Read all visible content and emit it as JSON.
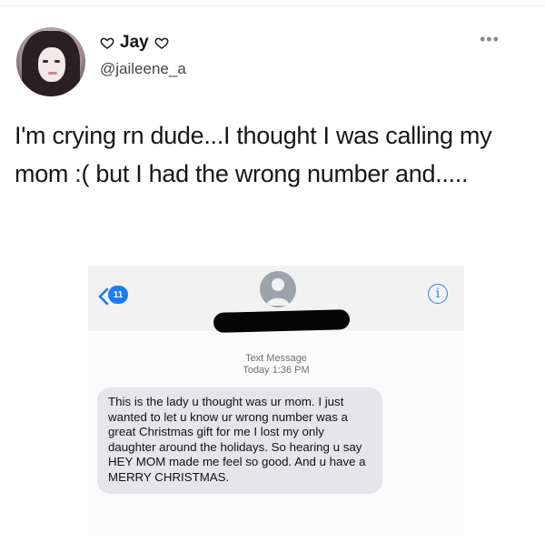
{
  "tweet": {
    "display_name": "Jay",
    "handle": "@jaileene_a",
    "text": "I'm crying rn dude...I thought I was calling my mom :( but I had the wrong number and.....",
    "more_icon": "ellipsis-icon",
    "name_decoration_icon": "heart-outline-icon"
  },
  "screenshot": {
    "unread_count": "11",
    "back_icon": "chevron-left-icon",
    "info_icon": "info-circle-icon",
    "contact_icon": "person-silhouette-icon",
    "meta_line1": "Text Message",
    "meta_line2": "Today 1:36 PM",
    "message": "This is the lady u thought was ur mom. I just wanted to let u know ur wrong number was a great Christmas gift for me I lost my only daughter around the holidays. So hearing u say HEY MOM made me feel so good. And u have a MERRY CHRISTMAS."
  },
  "colors": {
    "ios_blue": "#1e7bf0",
    "bubble_gray": "#e6e6ea",
    "redaction": "#050505"
  }
}
